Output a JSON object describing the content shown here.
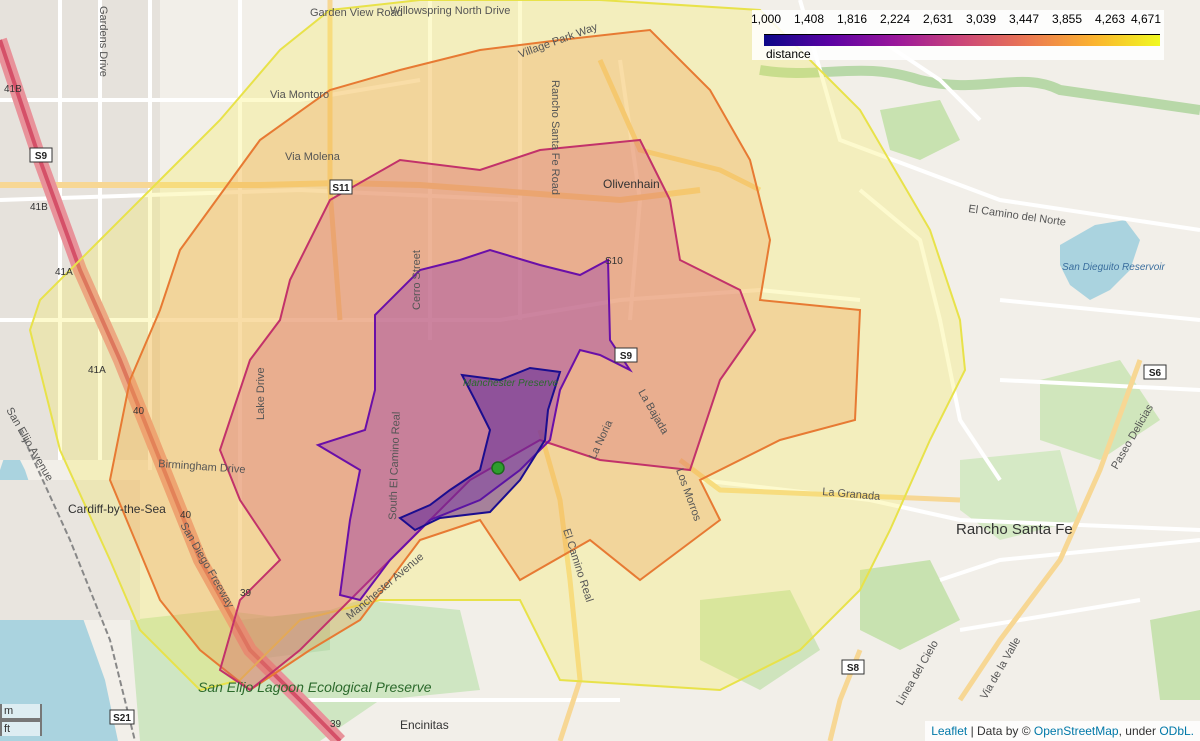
{
  "map": {
    "roads": [
      {
        "label": "Garden View Road"
      },
      {
        "label": "Willowspring North Drive"
      },
      {
        "label": "Village Park Way"
      },
      {
        "label": "Via Montoro"
      },
      {
        "label": "Via Molena"
      },
      {
        "label": "El Camino del Norte"
      },
      {
        "label": "Cerro Street"
      },
      {
        "label": "South El Camino Real"
      },
      {
        "label": "El Camino Real"
      },
      {
        "label": "Lake Drive"
      },
      {
        "label": "Birmingham Drive"
      },
      {
        "label": "San Diego Freeway"
      },
      {
        "label": "La Bajada"
      },
      {
        "label": "La Noria"
      },
      {
        "label": "La Granada"
      },
      {
        "label": "Paseo Delicias"
      },
      {
        "label": "Via de la Valle"
      },
      {
        "label": "Linea del Cielo"
      },
      {
        "label": "Manchester Avenue"
      },
      {
        "label": "Rancho Santa Fe Road"
      },
      {
        "label": "Los Morros"
      },
      {
        "label": "San Elijo Avenue"
      },
      {
        "label": "Gardens Drive"
      }
    ],
    "places": [
      {
        "label": "Olivenhain"
      },
      {
        "label": "Cardiff-by-the-Sea"
      },
      {
        "label": "Rancho Santa Fe"
      },
      {
        "label": "San Dieguito Reservoir"
      },
      {
        "label": "San Elijo Lagoon Ecological Preserve"
      },
      {
        "label": "Encinitas"
      },
      {
        "label": "Manchester Preserve"
      }
    ],
    "shields": [
      "S9",
      "S11",
      "S9",
      "S6",
      "S8",
      "S21",
      "41B",
      "41A",
      "41A",
      "40",
      "39",
      "39",
      "40",
      "S10"
    ],
    "marker": {
      "color": "#2e9e2e",
      "name": "origin"
    },
    "isochrones": [
      {
        "distance": 4671,
        "fill": "#f7eb3a",
        "stroke": "#e8e24a"
      },
      {
        "distance": 3855,
        "fill": "#f39a4c",
        "stroke": "#e77a33"
      },
      {
        "distance": 2631,
        "fill": "#d35575",
        "stroke": "#c2326a"
      },
      {
        "distance": 1408,
        "fill": "#8b2bb0",
        "stroke": "#6a0fa8"
      },
      {
        "distance": 1000,
        "fill": "#4a1a9c",
        "stroke": "#1b0d8f"
      }
    ]
  },
  "legend": {
    "ticks": [
      "1,000",
      "1,408",
      "1,816",
      "2,224",
      "2,631",
      "3,039",
      "3,447",
      "3,855",
      "4,263",
      "4,671"
    ],
    "caption": "distance",
    "colors": [
      "#0d0887",
      "#5b02a3",
      "#9a179b",
      "#cb4678",
      "#eb7852",
      "#fbb32f",
      "#f0f921"
    ]
  },
  "scale": {
    "top": "m",
    "bottom": "ft"
  },
  "attribution": {
    "leaflet": "Leaflet",
    "data_prefix": "| Data by ©",
    "osm": "OpenStreetMap",
    "under": ", under",
    "odbl": "ODbL."
  }
}
